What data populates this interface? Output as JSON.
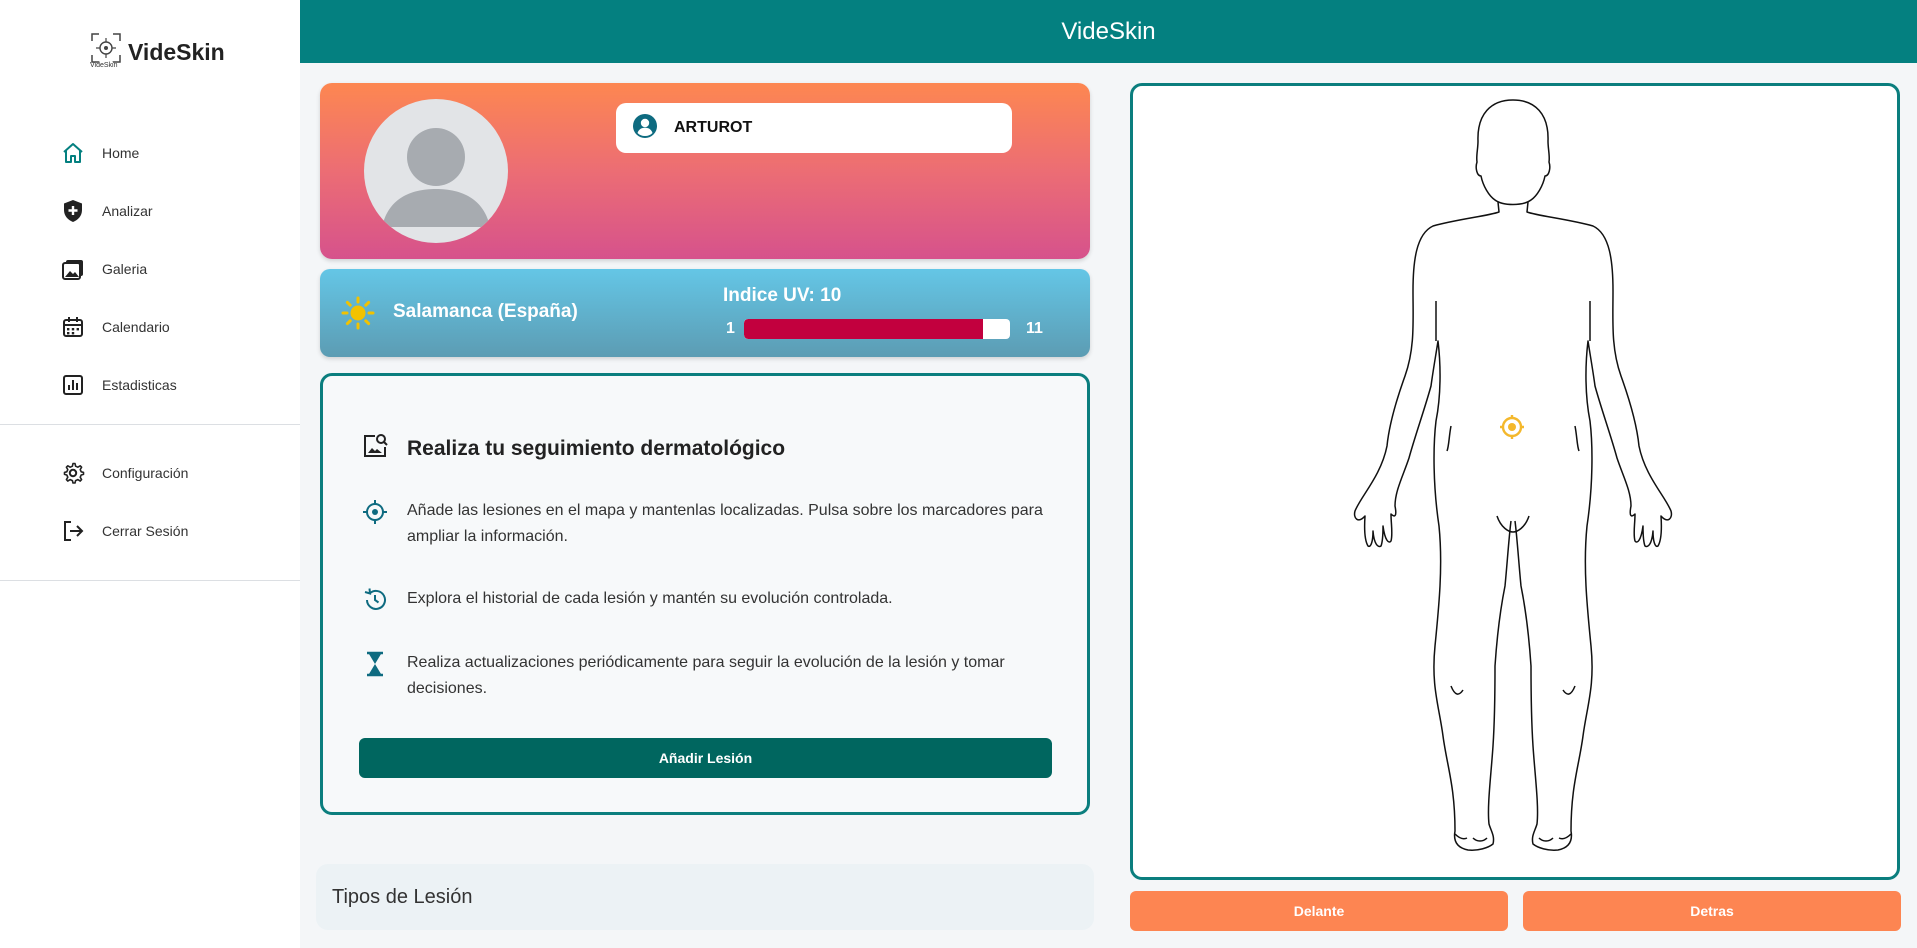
{
  "app": {
    "brand_name": "VideSkin",
    "brand_sub": "VideSkin",
    "header_title": "VideSkin"
  },
  "sidebar": {
    "items": [
      {
        "label": "Home",
        "icon": "home-icon"
      },
      {
        "label": "Analizar",
        "icon": "shield-plus-icon"
      },
      {
        "label": "Galeria",
        "icon": "gallery-icon"
      },
      {
        "label": "Calendario",
        "icon": "calendar-icon"
      },
      {
        "label": "Estadisticas",
        "icon": "stats-icon"
      }
    ],
    "bottom_items": [
      {
        "label": "Configuración",
        "icon": "gear-icon"
      },
      {
        "label": "Cerrar Sesión",
        "icon": "logout-icon"
      }
    ]
  },
  "profile": {
    "username": "ARTUROT"
  },
  "weather": {
    "city": "Salamanca (España)",
    "uv_title": "Indice UV: 10",
    "uv_value": 10,
    "uv_min": "1",
    "uv_max": "11"
  },
  "info": {
    "title": "Realiza tu seguimiento dermatológico",
    "items": [
      {
        "text": "Añade las lesiones en el mapa y mantenlas localizadas. Pulsa sobre los marcadores para ampliar la información.",
        "icon": "target-icon"
      },
      {
        "text": "Explora el historial de cada lesión y mantén su evolución controlada.",
        "icon": "history-icon"
      },
      {
        "text": "Realiza actualizaciones periódicamente para seguir la evolución de la lesión y tomar decisiones.",
        "icon": "hourglass-icon"
      }
    ],
    "add_button": "Añadir Lesión"
  },
  "tipos": {
    "label": "Tipos de Lesión"
  },
  "map": {
    "front_button": "Delante",
    "back_button": "Detras"
  },
  "colors": {
    "primary": "#048080",
    "accent_orange": "#fd8552",
    "uv_bar": "#c2003e",
    "marker": "#f4b82c"
  }
}
